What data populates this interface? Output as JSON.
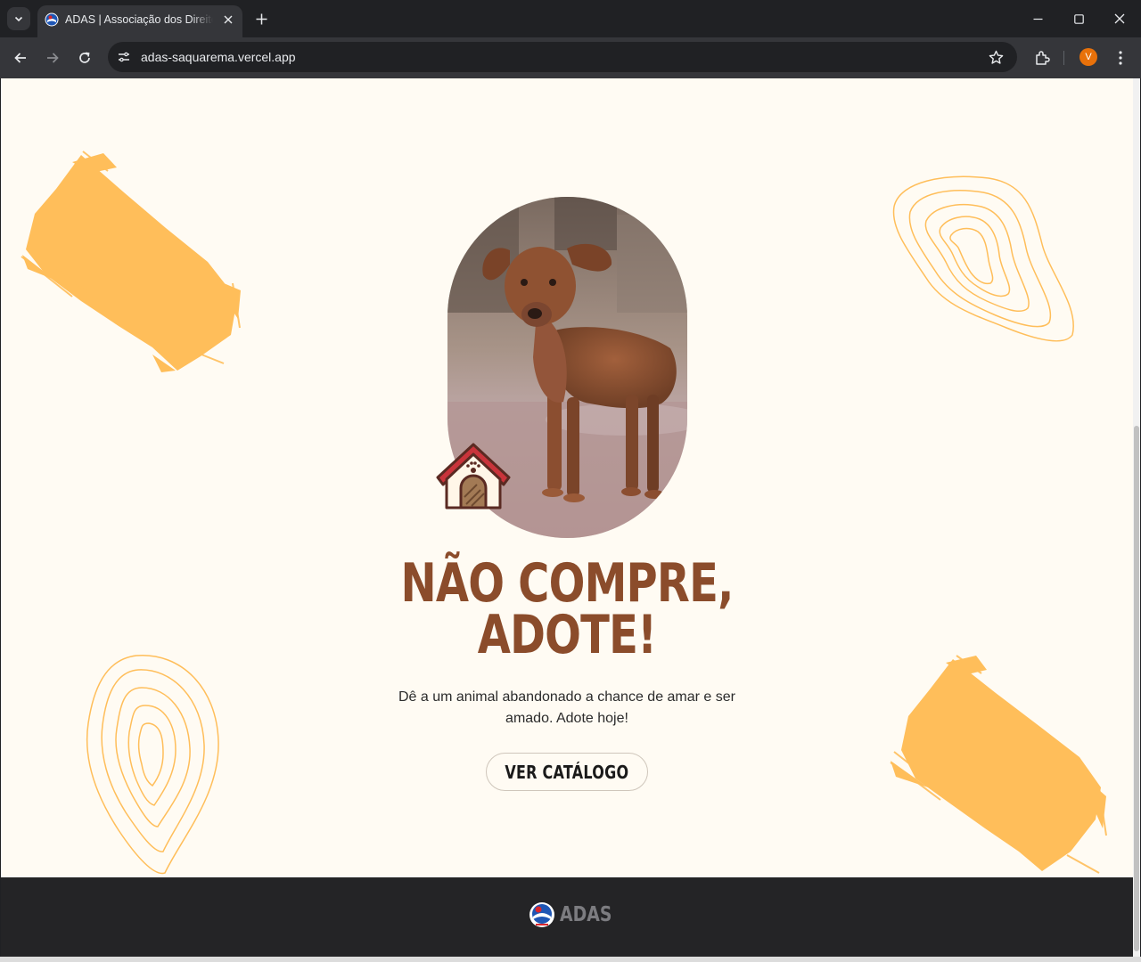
{
  "browser": {
    "tab_title": "ADAS | Associação dos Direitos",
    "url": "adas-saquarema.vercel.app",
    "profile_initial": "V"
  },
  "hero": {
    "title_line1": "NÃO COMPRE,",
    "title_line2": "ADOTE!",
    "subtitle": "Dê a um animal abandonado a chance de amar e ser amado. Adote hoje!",
    "cta_label": "VER CATÁLOGO"
  },
  "footer": {
    "brand": "ADAS"
  },
  "colors": {
    "page_bg": "#fffbf3",
    "title": "#8b4c2b",
    "brush": "#ffbe5a",
    "footer_bg": "#242426"
  },
  "icons": [
    "chevron-down-icon",
    "close-icon",
    "plus-icon",
    "minimize-icon",
    "maximize-icon",
    "back-icon",
    "forward-icon",
    "reload-icon",
    "site-info-icon",
    "star-icon",
    "extensions-icon",
    "more-icon",
    "dog-house-icon",
    "adas-logo"
  ]
}
